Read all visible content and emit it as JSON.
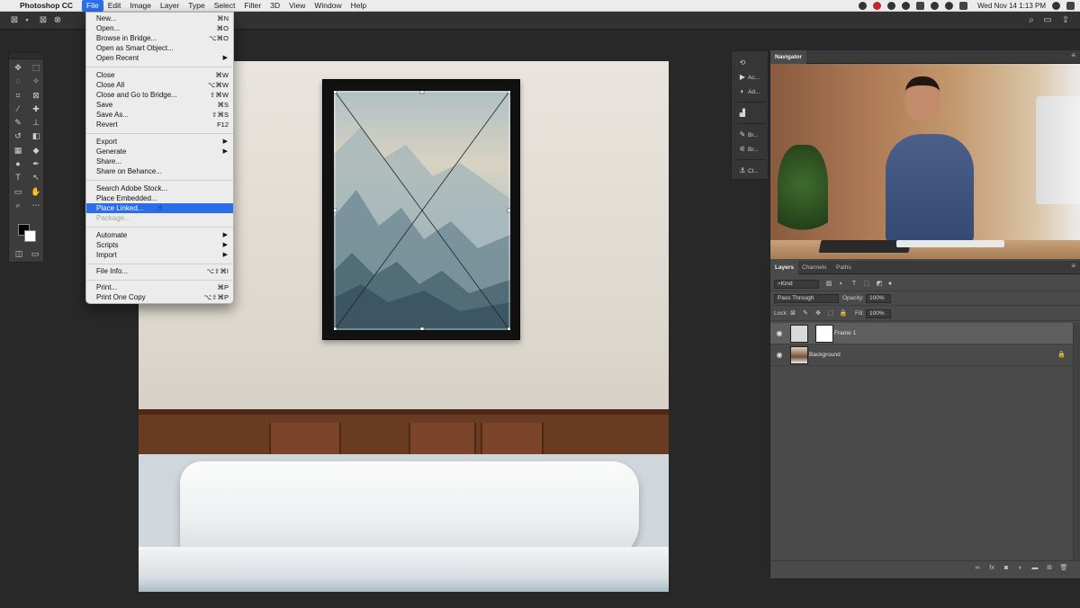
{
  "menubar": {
    "app_name": "Photoshop CC",
    "items": [
      "File",
      "Edit",
      "Image",
      "Layer",
      "Type",
      "Select",
      "Filter",
      "3D",
      "View",
      "Window",
      "Help"
    ],
    "clock": "Wed Nov 14  1:13 PM"
  },
  "file_menu": {
    "items": [
      {
        "label": "New...",
        "shortcut": "⌘N"
      },
      {
        "label": "Open...",
        "shortcut": "⌘O"
      },
      {
        "label": "Browse in Bridge...",
        "shortcut": "⌥⌘O"
      },
      {
        "label": "Open as Smart Object...",
        "shortcut": ""
      },
      {
        "label": "Open Recent",
        "shortcut": "",
        "submenu": true
      },
      {
        "label": "Close",
        "shortcut": "⌘W"
      },
      {
        "label": "Close All",
        "shortcut": "⌥⌘W"
      },
      {
        "label": "Close and Go to Bridge...",
        "shortcut": "⇧⌘W"
      },
      {
        "label": "Save",
        "shortcut": "⌘S"
      },
      {
        "label": "Save As...",
        "shortcut": "⇧⌘S"
      },
      {
        "label": "Revert",
        "shortcut": "F12"
      },
      {
        "label": "Export",
        "shortcut": "",
        "submenu": true
      },
      {
        "label": "Generate",
        "shortcut": "",
        "submenu": true
      },
      {
        "label": "Share...",
        "shortcut": ""
      },
      {
        "label": "Share on Behance...",
        "shortcut": ""
      },
      {
        "label": "Search Adobe Stock...",
        "shortcut": ""
      },
      {
        "label": "Place Embedded...",
        "shortcut": ""
      },
      {
        "label": "Place Linked...",
        "shortcut": "",
        "highlighted": true
      },
      {
        "label": "Package...",
        "shortcut": "",
        "disabled": true
      },
      {
        "label": "Automate",
        "shortcut": "",
        "submenu": true
      },
      {
        "label": "Scripts",
        "shortcut": "",
        "submenu": true
      },
      {
        "label": "Import",
        "shortcut": "",
        "submenu": true
      },
      {
        "label": "File Info...",
        "shortcut": "⌥⇧⌘I"
      },
      {
        "label": "Print...",
        "shortcut": "⌘P"
      },
      {
        "label": "Print One Copy",
        "shortcut": "⌥⇧⌘P"
      }
    ]
  },
  "icon_panel": {
    "items": [
      {
        "icon": "history-icon",
        "label": ""
      },
      {
        "icon": "actions-icon",
        "label": "Ac..."
      },
      {
        "icon": "adjustments-icon",
        "label": "Ad..."
      },
      {
        "icon": "histogram-icon",
        "label": ""
      },
      {
        "icon": "brush-icon",
        "label": "Br..."
      },
      {
        "icon": "brush-settings-icon",
        "label": "Br..."
      },
      {
        "icon": "clone-source-icon",
        "label": "Cl..."
      }
    ]
  },
  "navigator": {
    "tab": "Navigator"
  },
  "layers_panel": {
    "tabs": [
      "Layers",
      "Channels",
      "Paths"
    ],
    "filter_kind": "Kind",
    "blend_mode": "Pass Through",
    "opacity_label": "Opacity:",
    "opacity_value": "100%",
    "lock_label": "Lock:",
    "fill_label": "Fill:",
    "fill_value": "100%",
    "layers": [
      {
        "name": "Frame 1",
        "selected": true
      },
      {
        "name": "Background",
        "locked": true
      }
    ]
  },
  "colors": {
    "menu_highlight": "#2b6ee8",
    "panel_bg": "#4a4a4a",
    "workspace_bg": "#282828"
  }
}
